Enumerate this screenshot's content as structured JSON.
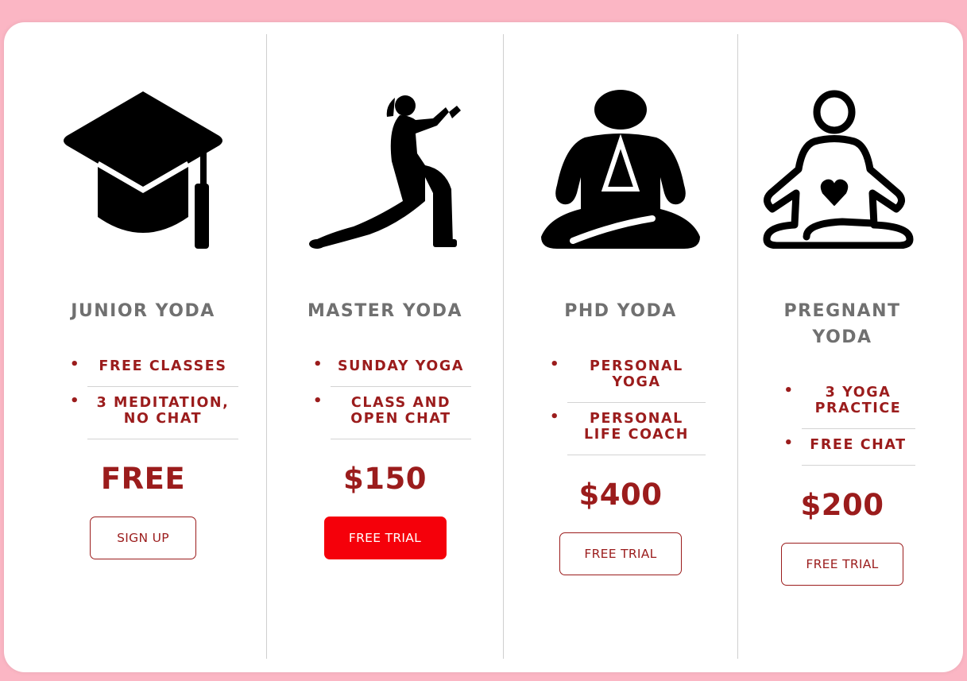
{
  "plans": [
    {
      "title": "JUNIOR YODA",
      "icon": "graduation-cap-icon",
      "features": [
        "FREE CLASSES",
        "3 MEDITATION, NO CHAT"
      ],
      "price": "FREE",
      "button": "SIGN UP"
    },
    {
      "title": "MASTER YODA",
      "icon": "martial-arts-pose-icon",
      "features": [
        "SUNDAY YOGA",
        "CLASS AND OPEN CHAT"
      ],
      "price": "$150",
      "button": "FREE TRIAL"
    },
    {
      "title": "PHD YODA",
      "icon": "meditation-pose-icon",
      "features": [
        "PERSONAL YOGA",
        "PERSONAL LIFE COACH"
      ],
      "price": "$400",
      "button": "FREE TRIAL"
    },
    {
      "title": "PREGNANT YODA",
      "icon": "pregnant-meditation-icon",
      "features": [
        "3 YOGA PRACTICE",
        "FREE CHAT"
      ],
      "price": "$200",
      "button": "FREE TRIAL"
    }
  ],
  "bullet": "•",
  "colors": {
    "background": "#fbb6c4",
    "accent": "#9b1c1c",
    "primary_button": "#f5000a",
    "title": "#707070"
  }
}
